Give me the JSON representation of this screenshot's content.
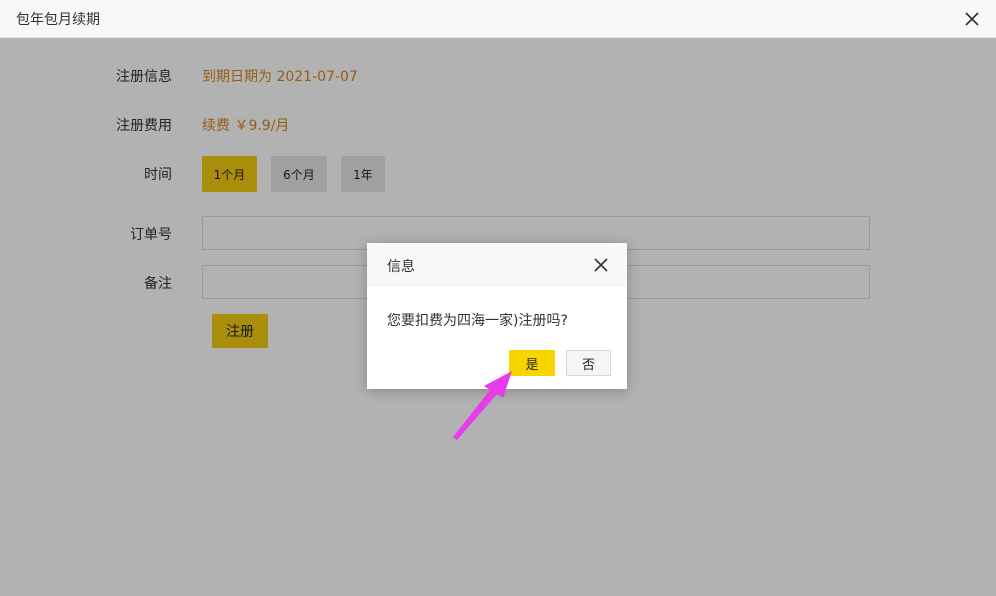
{
  "window": {
    "title": "包年包月续期",
    "close_icon": "close-icon"
  },
  "form": {
    "reg_info_label": "注册信息",
    "reg_info_value": "到期日期为 2021-07-07",
    "reg_fee_label": "注册费用",
    "reg_fee_value": "续费 ￥9.9/月",
    "time_label": "时间",
    "time_options": [
      "1个月",
      "6个月",
      "1年"
    ],
    "time_selected": "1个月",
    "order_label": "订单号",
    "order_value": "",
    "remark_label": "备注",
    "remark_value": "",
    "submit_label": "注册"
  },
  "dialog": {
    "title": "信息",
    "message": "您要扣费为四海一家)注册吗?",
    "yes_label": "是",
    "no_label": "否"
  },
  "colors": {
    "accent": "#f3cc10",
    "value_text": "#d4891c",
    "annotation_arrow": "#e83ce8"
  }
}
